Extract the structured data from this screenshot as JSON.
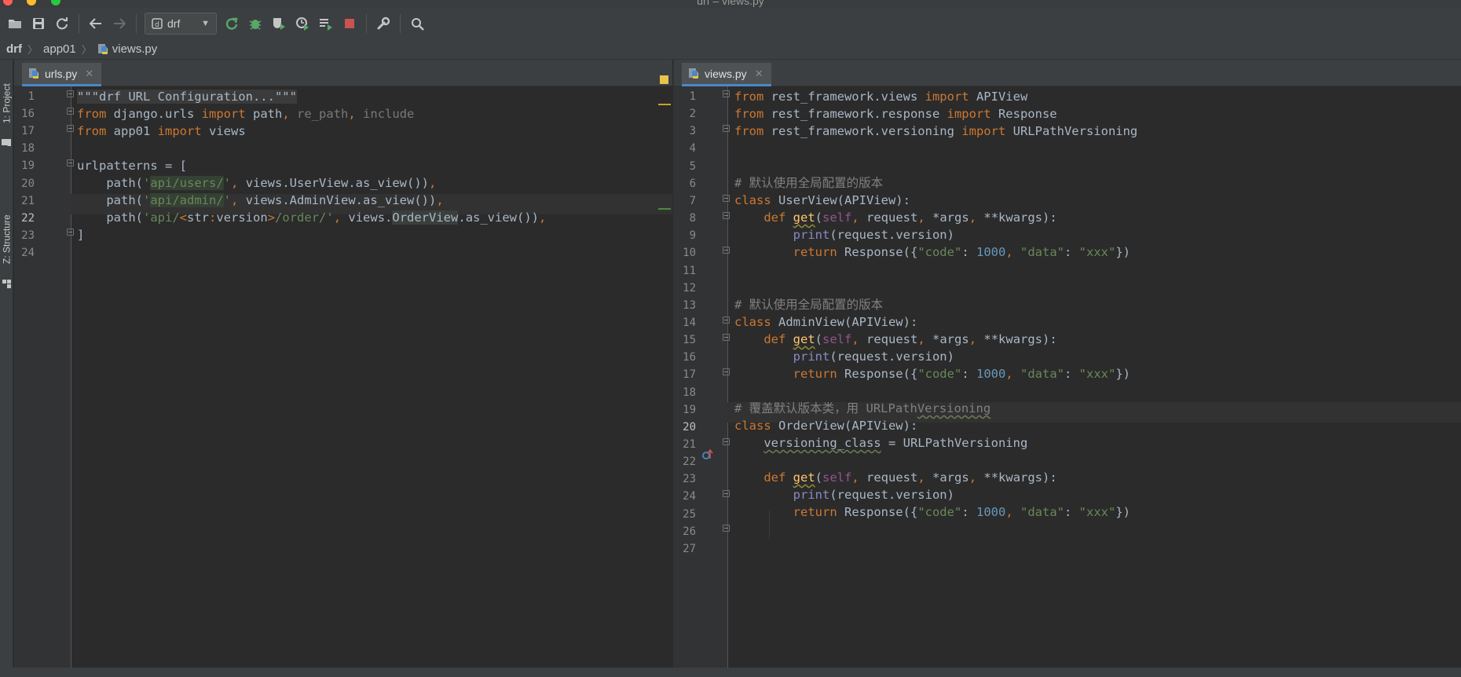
{
  "window": {
    "title": "drf – views.py"
  },
  "toolbar": {
    "run_config": "drf"
  },
  "breadcrumb": [
    "drf",
    "app01",
    "views.py"
  ],
  "side_tabs": {
    "project": "1: Project",
    "structure": "Z: Structure"
  },
  "left_editor": {
    "tab": "urls.py",
    "line_numbers": [
      "1",
      "16",
      "17",
      "18",
      "19",
      "20",
      "21",
      "22",
      "23",
      "24"
    ],
    "current_line": "22"
  },
  "right_editor": {
    "tab": "views.py",
    "line_numbers": [
      "1",
      "2",
      "3",
      "4",
      "5",
      "6",
      "7",
      "8",
      "9",
      "10",
      "11",
      "12",
      "13",
      "14",
      "15",
      "16",
      "17",
      "18",
      "19",
      "20",
      "21",
      "22",
      "23",
      "24",
      "25",
      "26",
      "27"
    ],
    "current_line": "20"
  },
  "colors": {
    "background": "#2b2b2b",
    "keyword": "#cc7832",
    "string": "#6a8759",
    "number": "#6897bb",
    "comment": "#808080",
    "function": "#ffc66d",
    "self": "#94558d",
    "builtin": "#8888c6",
    "text": "#a9b7c6"
  }
}
